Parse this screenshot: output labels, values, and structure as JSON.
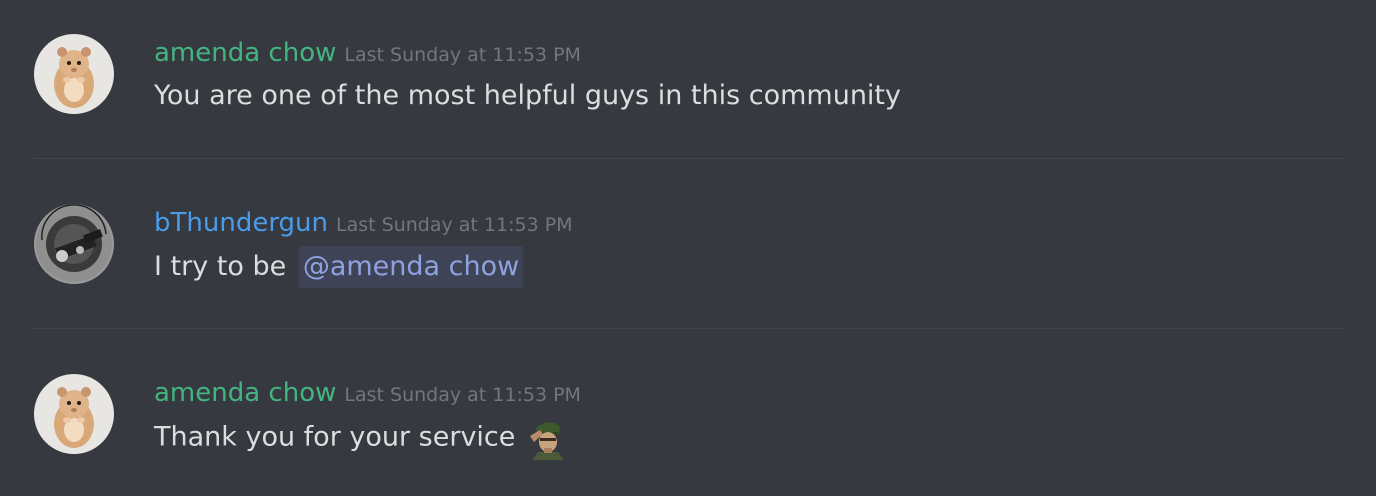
{
  "messages": [
    {
      "author": "amenda chow",
      "timestamp": "Last Sunday at 11:53 PM",
      "text": "You are one of the most helpful guys in this community",
      "avatar_icon": "hamster-avatar",
      "name_color": "#43b581"
    },
    {
      "author": "bThundergun",
      "timestamp": "Last Sunday at 11:53 PM",
      "text": "I try to be",
      "mention": "@amenda chow",
      "avatar_icon": "thundergun-logo-avatar",
      "name_color": "#4a9be8"
    },
    {
      "author": "amenda chow",
      "timestamp": "Last Sunday at 11:53 PM",
      "text": "Thank you for your service",
      "emoji_icon": "saluting-soldier-emoji",
      "avatar_icon": "hamster-avatar",
      "name_color": "#43b581"
    }
  ],
  "colors": {
    "background": "#36393f",
    "message_text": "#dcddde",
    "timestamp": "#72767d",
    "mention_text": "#8ea1e1",
    "divider": "#42454b"
  }
}
